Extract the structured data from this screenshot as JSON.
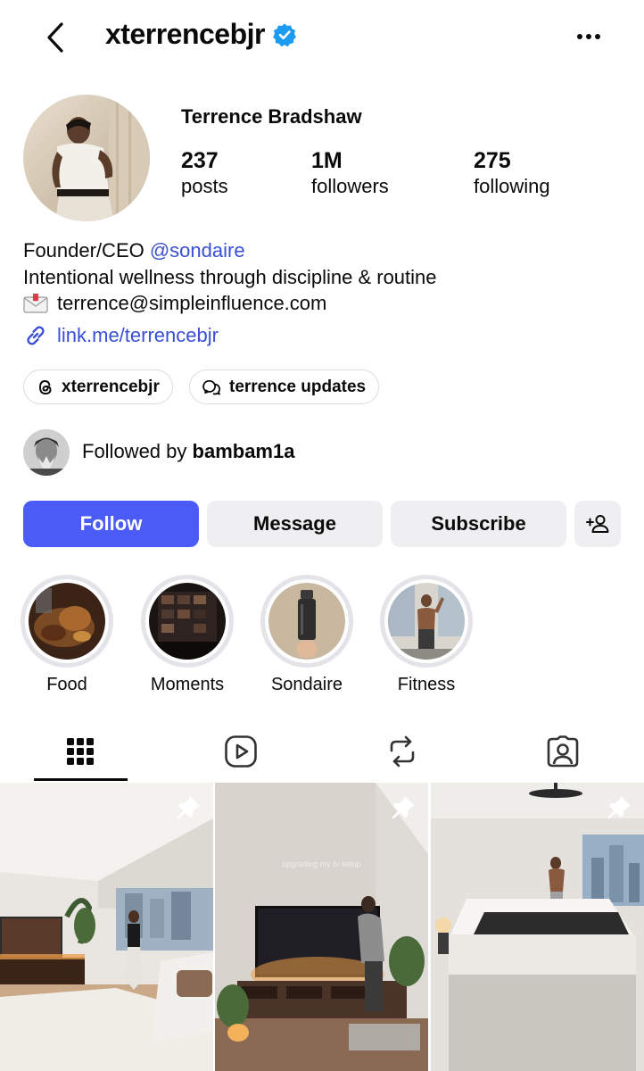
{
  "header": {
    "username": "xterrencebjr"
  },
  "profile": {
    "full_name": "Terrence Bradshaw",
    "stats": [
      {
        "value": "237",
        "label": "posts"
      },
      {
        "value": "1M",
        "label": "followers"
      },
      {
        "value": "275",
        "label": "following"
      }
    ]
  },
  "bio": {
    "line1_prefix": "Founder/CEO ",
    "line1_mention": "@sondaire",
    "line2": "Intentional wellness through discipline & routine",
    "line3": "terrence@simpleinfluence.com",
    "link": "link.me/terrencebjr"
  },
  "chips": [
    {
      "label": "xterrencebjr",
      "icon": "threads-icon"
    },
    {
      "label": "terrence updates",
      "icon": "broadcast-channel-icon"
    }
  ],
  "followed_by": {
    "prefix": "Followed by ",
    "name": "bambam1a"
  },
  "actions": {
    "follow": "Follow",
    "message": "Message",
    "subscribe": "Subscribe"
  },
  "highlights": [
    {
      "label": "Food"
    },
    {
      "label": "Moments"
    },
    {
      "label": "Sondaire"
    },
    {
      "label": "Fitness"
    }
  ],
  "tabs": [
    {
      "name": "grid-icon",
      "active": true
    },
    {
      "name": "reels-icon",
      "active": false
    },
    {
      "name": "reposts-icon",
      "active": false
    },
    {
      "name": "tagged-icon",
      "active": false
    }
  ],
  "posts": [
    {
      "pinned": true,
      "caption": ""
    },
    {
      "pinned": true,
      "caption": "upgrading my tv setup"
    },
    {
      "pinned": true,
      "caption": ""
    }
  ],
  "colors": {
    "accent": "#4a5cf5",
    "link": "#3a4fd4",
    "verified": "#1d9bf0",
    "button_bg": "#efeff1"
  }
}
